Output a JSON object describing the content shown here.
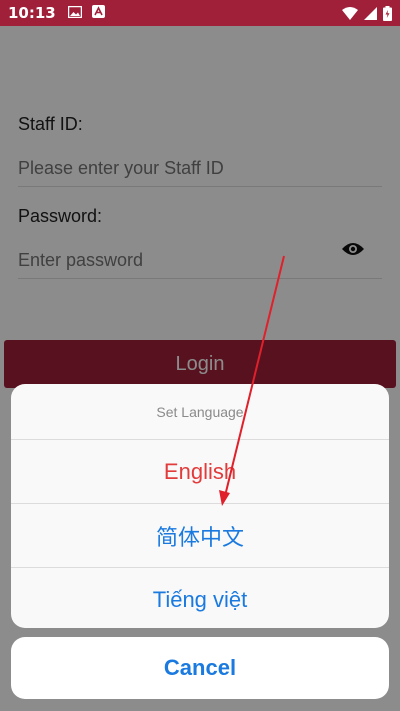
{
  "status_bar": {
    "time": "10:13",
    "left_icons": [
      "image-icon",
      "app-notification-icon"
    ],
    "right_icons": [
      "wifi-icon",
      "signal-icon",
      "battery-icon"
    ]
  },
  "login_form": {
    "staff_id_label": "Staff ID:",
    "staff_id_placeholder": "Please enter your Staff ID",
    "password_label": "Password:",
    "password_placeholder": "Enter password",
    "toggle_icon": "eye-icon",
    "login_label": "Login"
  },
  "language_sheet": {
    "title": "Set Language",
    "options": [
      {
        "label": "English",
        "selected": true
      },
      {
        "label": "简体中文",
        "selected": false
      },
      {
        "label": "Tiếng việt",
        "selected": false
      }
    ],
    "cancel_label": "Cancel"
  },
  "colors": {
    "brand": "#a0203a",
    "selected_option": "#e23b3b",
    "option_text": "#1a7ae0",
    "annotation_arrow": "#e0202a"
  }
}
